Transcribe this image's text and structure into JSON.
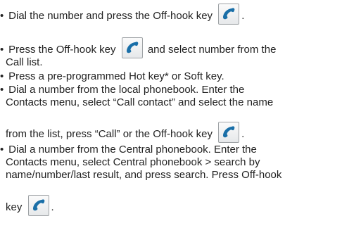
{
  "icons": {
    "offhook": "handset-icon",
    "handset_color": "#1a6fa8"
  },
  "lines": {
    "l1_text": "Dial the number and press the Off-hook key",
    "l1_end": ".",
    "l2_text": "Press the Off-hook key",
    "l2_end": "and select number from the",
    "l3": "Call list.",
    "l4": "Press a pre-programmed Hot key* or Soft key.",
    "l5": "Dial a number from the local phonebook. Enter the",
    "l6": "Contacts menu, select “Call contact” and select the name",
    "l7_text": "from the list, press “Call” or the Off-hook key",
    "l7_end": ".",
    "l8": "Dial a number from the Central phonebook. Enter the",
    "l9": "Contacts menu, select Central phonebook > search by",
    "l10": "name/number/last result, and press search. Press Off-hook",
    "l11_text": "key",
    "l11_end": "."
  }
}
